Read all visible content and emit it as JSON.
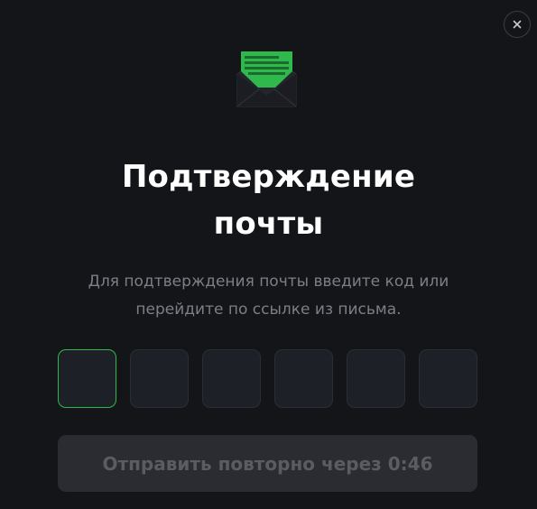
{
  "dialog": {
    "close_label": "×",
    "envelope_icon": "mail-open-icon",
    "title_line1": "Подтверждение",
    "title_line2": "почты",
    "subtitle_line1": "Для подтверждения почты введите код или",
    "subtitle_line2": "перейдите по ссылке из письма.",
    "code_cells": [
      "",
      "",
      "",
      "",
      "",
      ""
    ],
    "active_cell_index": 0,
    "resend_label": "Отправить повторно через 0:46"
  },
  "colors": {
    "background": "#131519",
    "accent_green": "#2fb84c",
    "cell_background": "#1d2027",
    "button_background": "#2a2c31",
    "button_text": "#5a5c61",
    "subtitle_text": "#7c7f86",
    "title_text": "#ffffff"
  }
}
